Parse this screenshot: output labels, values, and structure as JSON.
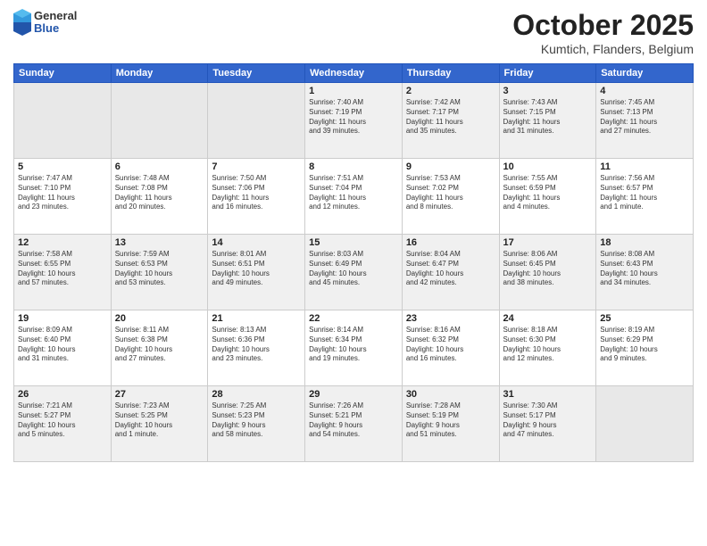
{
  "header": {
    "logo_general": "General",
    "logo_blue": "Blue",
    "month": "October 2025",
    "location": "Kumtich, Flanders, Belgium"
  },
  "days_of_week": [
    "Sunday",
    "Monday",
    "Tuesday",
    "Wednesday",
    "Thursday",
    "Friday",
    "Saturday"
  ],
  "weeks": [
    [
      {
        "day": "",
        "info": ""
      },
      {
        "day": "",
        "info": ""
      },
      {
        "day": "",
        "info": ""
      },
      {
        "day": "1",
        "info": "Sunrise: 7:40 AM\nSunset: 7:19 PM\nDaylight: 11 hours\nand 39 minutes."
      },
      {
        "day": "2",
        "info": "Sunrise: 7:42 AM\nSunset: 7:17 PM\nDaylight: 11 hours\nand 35 minutes."
      },
      {
        "day": "3",
        "info": "Sunrise: 7:43 AM\nSunset: 7:15 PM\nDaylight: 11 hours\nand 31 minutes."
      },
      {
        "day": "4",
        "info": "Sunrise: 7:45 AM\nSunset: 7:13 PM\nDaylight: 11 hours\nand 27 minutes."
      }
    ],
    [
      {
        "day": "5",
        "info": "Sunrise: 7:47 AM\nSunset: 7:10 PM\nDaylight: 11 hours\nand 23 minutes."
      },
      {
        "day": "6",
        "info": "Sunrise: 7:48 AM\nSunset: 7:08 PM\nDaylight: 11 hours\nand 20 minutes."
      },
      {
        "day": "7",
        "info": "Sunrise: 7:50 AM\nSunset: 7:06 PM\nDaylight: 11 hours\nand 16 minutes."
      },
      {
        "day": "8",
        "info": "Sunrise: 7:51 AM\nSunset: 7:04 PM\nDaylight: 11 hours\nand 12 minutes."
      },
      {
        "day": "9",
        "info": "Sunrise: 7:53 AM\nSunset: 7:02 PM\nDaylight: 11 hours\nand 8 minutes."
      },
      {
        "day": "10",
        "info": "Sunrise: 7:55 AM\nSunset: 6:59 PM\nDaylight: 11 hours\nand 4 minutes."
      },
      {
        "day": "11",
        "info": "Sunrise: 7:56 AM\nSunset: 6:57 PM\nDaylight: 11 hours\nand 1 minute."
      }
    ],
    [
      {
        "day": "12",
        "info": "Sunrise: 7:58 AM\nSunset: 6:55 PM\nDaylight: 10 hours\nand 57 minutes."
      },
      {
        "day": "13",
        "info": "Sunrise: 7:59 AM\nSunset: 6:53 PM\nDaylight: 10 hours\nand 53 minutes."
      },
      {
        "day": "14",
        "info": "Sunrise: 8:01 AM\nSunset: 6:51 PM\nDaylight: 10 hours\nand 49 minutes."
      },
      {
        "day": "15",
        "info": "Sunrise: 8:03 AM\nSunset: 6:49 PM\nDaylight: 10 hours\nand 45 minutes."
      },
      {
        "day": "16",
        "info": "Sunrise: 8:04 AM\nSunset: 6:47 PM\nDaylight: 10 hours\nand 42 minutes."
      },
      {
        "day": "17",
        "info": "Sunrise: 8:06 AM\nSunset: 6:45 PM\nDaylight: 10 hours\nand 38 minutes."
      },
      {
        "day": "18",
        "info": "Sunrise: 8:08 AM\nSunset: 6:43 PM\nDaylight: 10 hours\nand 34 minutes."
      }
    ],
    [
      {
        "day": "19",
        "info": "Sunrise: 8:09 AM\nSunset: 6:40 PM\nDaylight: 10 hours\nand 31 minutes."
      },
      {
        "day": "20",
        "info": "Sunrise: 8:11 AM\nSunset: 6:38 PM\nDaylight: 10 hours\nand 27 minutes."
      },
      {
        "day": "21",
        "info": "Sunrise: 8:13 AM\nSunset: 6:36 PM\nDaylight: 10 hours\nand 23 minutes."
      },
      {
        "day": "22",
        "info": "Sunrise: 8:14 AM\nSunset: 6:34 PM\nDaylight: 10 hours\nand 19 minutes."
      },
      {
        "day": "23",
        "info": "Sunrise: 8:16 AM\nSunset: 6:32 PM\nDaylight: 10 hours\nand 16 minutes."
      },
      {
        "day": "24",
        "info": "Sunrise: 8:18 AM\nSunset: 6:30 PM\nDaylight: 10 hours\nand 12 minutes."
      },
      {
        "day": "25",
        "info": "Sunrise: 8:19 AM\nSunset: 6:29 PM\nDaylight: 10 hours\nand 9 minutes."
      }
    ],
    [
      {
        "day": "26",
        "info": "Sunrise: 7:21 AM\nSunset: 5:27 PM\nDaylight: 10 hours\nand 5 minutes."
      },
      {
        "day": "27",
        "info": "Sunrise: 7:23 AM\nSunset: 5:25 PM\nDaylight: 10 hours\nand 1 minute."
      },
      {
        "day": "28",
        "info": "Sunrise: 7:25 AM\nSunset: 5:23 PM\nDaylight: 9 hours\nand 58 minutes."
      },
      {
        "day": "29",
        "info": "Sunrise: 7:26 AM\nSunset: 5:21 PM\nDaylight: 9 hours\nand 54 minutes."
      },
      {
        "day": "30",
        "info": "Sunrise: 7:28 AM\nSunset: 5:19 PM\nDaylight: 9 hours\nand 51 minutes."
      },
      {
        "day": "31",
        "info": "Sunrise: 7:30 AM\nSunset: 5:17 PM\nDaylight: 9 hours\nand 47 minutes."
      },
      {
        "day": "",
        "info": ""
      }
    ]
  ],
  "shaded_rows": [
    0,
    2,
    4
  ]
}
